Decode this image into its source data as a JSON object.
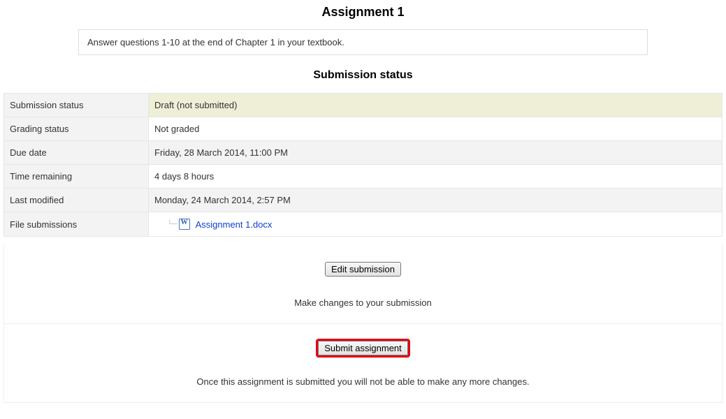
{
  "title": "Assignment 1",
  "instructions": "Answer questions 1-10 at the end of Chapter 1 in your textbook.",
  "status_heading": "Submission status",
  "rows": {
    "submission_status": {
      "label": "Submission status",
      "value": "Draft (not submitted)"
    },
    "grading_status": {
      "label": "Grading status",
      "value": "Not graded"
    },
    "due_date": {
      "label": "Due date",
      "value": "Friday, 28 March 2014, 11:00 PM"
    },
    "time_remaining": {
      "label": "Time remaining",
      "value": "4 days 8 hours"
    },
    "last_modified": {
      "label": "Last modified",
      "value": "Monday, 24 March 2014, 2:57 PM"
    },
    "file_submissions": {
      "label": "File submissions",
      "file_name": "Assignment 1.docx"
    }
  },
  "edit_button": "Edit submission",
  "edit_hint": "Make changes to your submission",
  "submit_button": "Submit assignment",
  "submit_hint": "Once this assignment is submitted you will not be able to make any more changes."
}
